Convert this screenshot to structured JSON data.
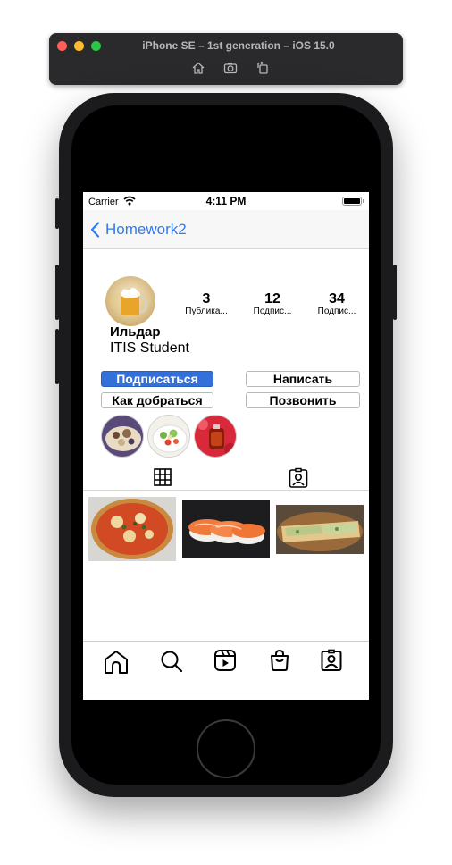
{
  "simulator": {
    "title": "iPhone SE – 1st generation – iOS 15.0",
    "toolbar_icons": [
      "home-icon",
      "camera-icon",
      "rotate-icon"
    ]
  },
  "status_bar": {
    "carrier": "Carrier",
    "time": "4:11 PM"
  },
  "nav": {
    "back_label": "Homework2"
  },
  "profile": {
    "name": "Ильдар",
    "bio": "ITIS Student",
    "stats": [
      {
        "value": "3",
        "label": "Публика..."
      },
      {
        "value": "12",
        "label": "Подпис..."
      },
      {
        "value": "34",
        "label": "Подпис..."
      }
    ]
  },
  "actions": {
    "subscribe": "Подписаться",
    "message": "Написать",
    "directions": "Как добраться",
    "call": "Позвонить"
  },
  "tabs": [
    {
      "icon": "grid-icon"
    },
    {
      "icon": "tagged-person-icon"
    }
  ],
  "bottom_bar": [
    {
      "icon": "home-icon"
    },
    {
      "icon": "search-icon"
    },
    {
      "icon": "reels-icon"
    },
    {
      "icon": "shop-bag-icon"
    },
    {
      "icon": "profile-icon"
    }
  ],
  "colors": {
    "accent": "#2f7bf0",
    "primary_button": "#3370d9"
  }
}
